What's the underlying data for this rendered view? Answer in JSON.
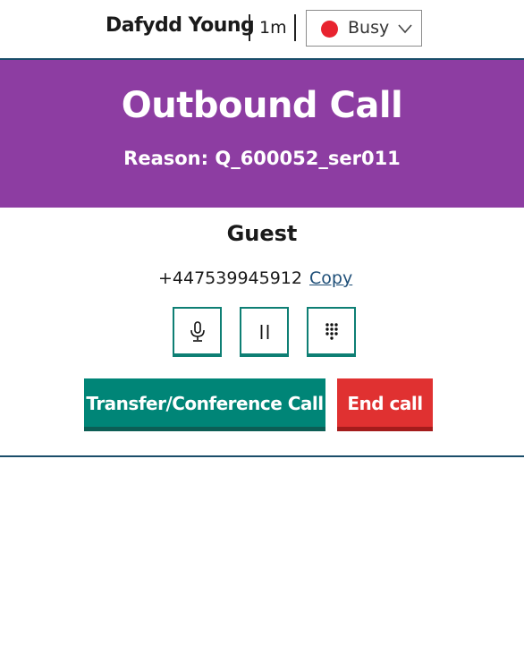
{
  "header": {
    "agent_name": "Dafydd Young",
    "timer": "1m",
    "status": {
      "label": "Busy",
      "color": "#e8232f"
    }
  },
  "banner": {
    "title": "Outbound Call",
    "reason": "Reason: Q_600052_ser011",
    "background": "#8d3da2"
  },
  "caller": {
    "name": "Guest",
    "phone": "+447539945912",
    "copy_label": "Copy"
  },
  "controls": {
    "icons": [
      "microphone-icon",
      "pause-icon",
      "keypad-icon"
    ],
    "accent": "#008577"
  },
  "actions": {
    "transfer_label": "Transfer/Conference Call",
    "end_label": "End call",
    "end_color": "#e03131"
  }
}
